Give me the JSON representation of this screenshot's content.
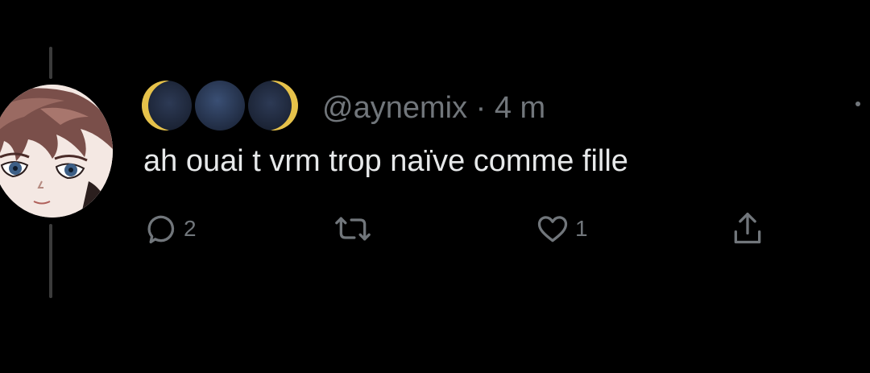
{
  "tweet": {
    "display_name_emojis": [
      "last-quarter-moon",
      "new-moon",
      "first-quarter-moon"
    ],
    "handle": "@aynemix",
    "separator": "·",
    "timestamp": "4 m",
    "text": "ah ouai t vrm trop naïve comme fille"
  },
  "actions": {
    "reply_count": "2",
    "retweet_count": "",
    "like_count": "1"
  },
  "colors": {
    "background": "#000000",
    "text": "#e7e9ea",
    "secondary": "#71767b",
    "thread_line": "#3b3b3b"
  },
  "icons": {
    "reply": "reply-icon",
    "retweet": "retweet-icon",
    "like": "heart-icon",
    "share": "share-icon",
    "more": "more-icon"
  }
}
